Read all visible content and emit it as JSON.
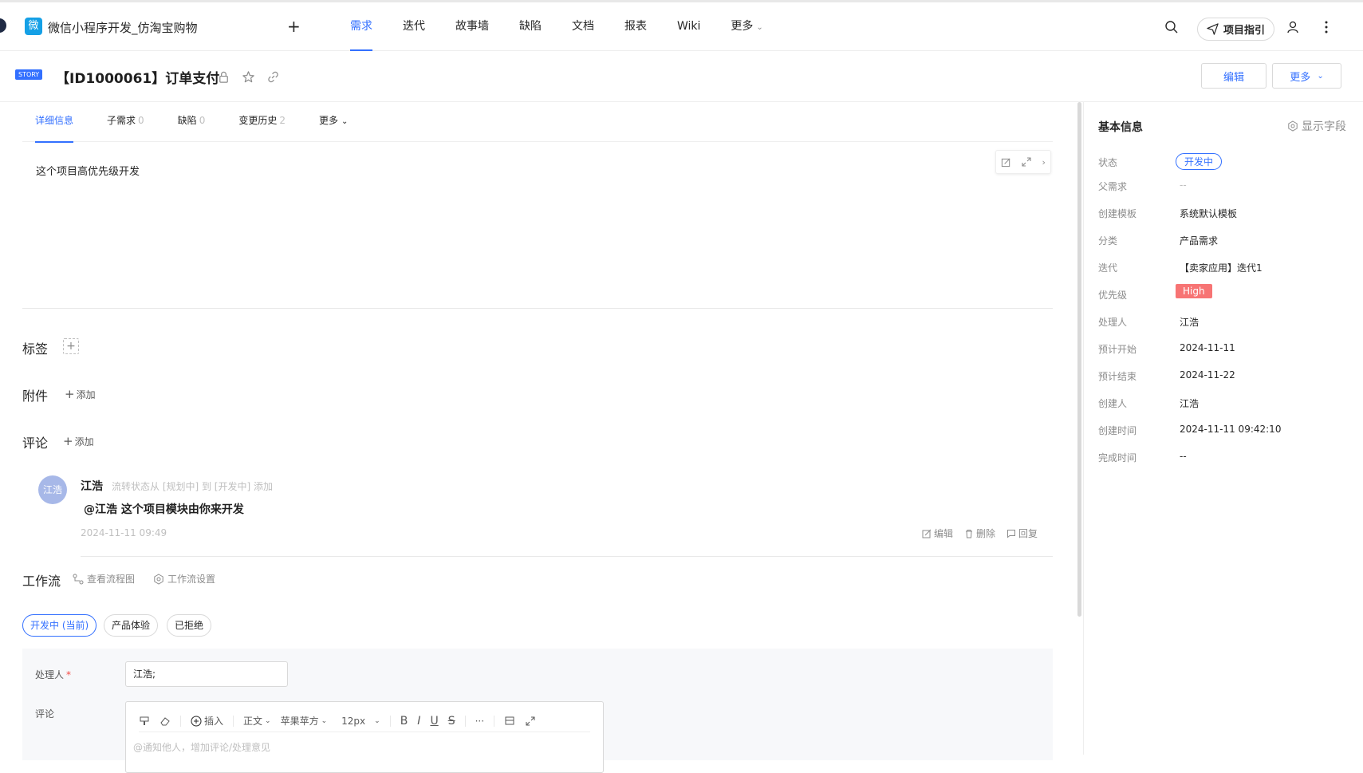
{
  "app": {
    "logo_char": "微",
    "name": "微信小程序开发_仿淘宝购物",
    "add_label": "+"
  },
  "nav": {
    "items": [
      {
        "label": "需求"
      },
      {
        "label": "迭代"
      },
      {
        "label": "故事墙"
      },
      {
        "label": "缺陷"
      },
      {
        "label": "文档"
      },
      {
        "label": "报表"
      },
      {
        "label": "Wiki"
      },
      {
        "label": "更多"
      }
    ],
    "guide_label": "项目指引"
  },
  "story": {
    "type_tag": "STORY",
    "title": "【ID1000061】订单支付",
    "edit_label": "编辑",
    "more_label": "更多"
  },
  "tabs": [
    {
      "label": "详细信息",
      "count": ""
    },
    {
      "label": "子需求",
      "count": "0"
    },
    {
      "label": "缺陷",
      "count": "0"
    },
    {
      "label": "变更历史",
      "count": "2"
    },
    {
      "label": "更多",
      "count": ""
    }
  ],
  "description": "这个项目高优先级开发",
  "sections": {
    "tags_label": "标签",
    "attach_label": "附件",
    "comment_label": "评论",
    "add_label": "添加",
    "workflow_label": "工作流",
    "view_flow_label": "查看流程图",
    "flow_settings_label": "工作流设置"
  },
  "comment": {
    "avatar_text": "江浩",
    "author": "江浩",
    "action": "流转状态从 [规划中] 到 [开发中] 添加",
    "body": "@江浩 这个项目模块由你来开发",
    "time": "2024-11-11 09:49",
    "edit_label": "编辑",
    "delete_label": "删除",
    "reply_label": "回复"
  },
  "workflow": {
    "states": [
      {
        "label": "开发中 (当前)"
      },
      {
        "label": "产品体验"
      },
      {
        "label": "已拒绝"
      }
    ]
  },
  "form": {
    "assignee_label": "处理人",
    "required_mark": "*",
    "assignee_value": "江浩;",
    "comment_label": "评论",
    "toolbar": {
      "insert": "插入",
      "paragraph": "正文",
      "font": "苹果苹方",
      "size": "12px",
      "bold": "B",
      "italic": "I",
      "underline": "U",
      "strike": "S",
      "more": "···"
    },
    "editor_placeholder": "@通知他人，增加评论/处理意见"
  },
  "sidebar": {
    "title": "基本信息",
    "fields_label": "显示字段",
    "rows": [
      {
        "key": "状态",
        "value": "开发中"
      },
      {
        "key": "父需求",
        "value": "--"
      },
      {
        "key": "创建模板",
        "value": "系统默认模板"
      },
      {
        "key": "分类",
        "value": "产品需求"
      },
      {
        "key": "迭代",
        "value": "【卖家应用】迭代1"
      },
      {
        "key": "优先级",
        "value": "High"
      },
      {
        "key": "处理人",
        "value": "江浩"
      },
      {
        "key": "预计开始",
        "value": "2024-11-11"
      },
      {
        "key": "预计结束",
        "value": "2024-11-22"
      },
      {
        "key": "创建人",
        "value": "江浩"
      },
      {
        "key": "创建时间",
        "value": "2024-11-11 09:42:10"
      },
      {
        "key": "完成时间",
        "value": "--"
      }
    ]
  },
  "colors": {
    "accent": "#3370ff",
    "priority_high": "#f77474",
    "logo": "#15a0e6"
  }
}
